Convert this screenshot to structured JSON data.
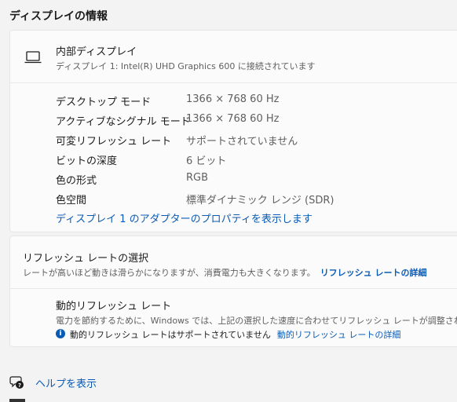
{
  "section_title": "ディスプレイの情報",
  "display": {
    "name": "内部ディスプレイ",
    "connection": "ディスプレイ 1: Intel(R) UHD Graphics 600 に接続されています",
    "icon": "laptop-icon"
  },
  "properties": [
    {
      "label": "デスクトップ モード",
      "value": "1366 × 768 60 Hz"
    },
    {
      "label": "アクティブなシグナル モード",
      "value": "1366 × 768 60 Hz"
    },
    {
      "label": "可変リフレッシュ レート",
      "value": "サポートされていません"
    },
    {
      "label": "ビットの深度",
      "value": "6 ビット"
    },
    {
      "label": "色の形式",
      "value": "RGB"
    },
    {
      "label": "色空間",
      "value": "標準ダイナミック レンジ (SDR)"
    }
  ],
  "adapter_link": "ディスプレイ 1 のアダプターのプロパティを表示します",
  "refresh": {
    "title": "リフレッシュ レートの選択",
    "description": "レートが高いほど動きは滑らかになりますが、消費電力も大きくなります。",
    "details_link": "リフレッシュ レートの詳細"
  },
  "dynamic_refresh": {
    "title": "動的リフレッシュ レート",
    "description": "電力を節約するために、Windows では、上記の選択した速度に合わせてリフレッシュ レートが調整されます",
    "note": "動的リフレッシュ レートはサポートされていません",
    "details_link": "動的リフレッシュ レートの詳細"
  },
  "help_link": "ヘルプを表示",
  "colors": {
    "accent": "#0a5bb5",
    "background": "#f3f3f3",
    "card": "#fbfbfb"
  }
}
